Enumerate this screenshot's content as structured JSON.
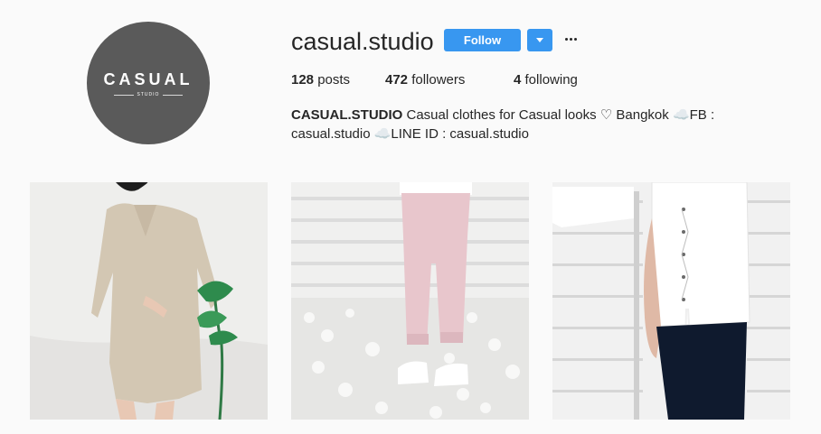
{
  "profile": {
    "username": "casual.studio",
    "avatar_logo_word": "CASUAL",
    "avatar_logo_sub": "STUDIO"
  },
  "actions": {
    "follow_label": "Follow",
    "dropdown_icon": "chevron-down-icon",
    "more_icon": "more-options-icon",
    "accent_color": "#3897f0"
  },
  "stats": {
    "posts_count": "128",
    "posts_label": "posts",
    "followers_count": "472",
    "followers_label": "followers",
    "following_count": "4",
    "following_label": "following"
  },
  "bio": {
    "full_name": "CASUAL.STUDIO",
    "text": " Casual clothes for Casual looks ♡ Bangkok ☁️FB : casual.studio ☁️LINE ID : casual.studio"
  },
  "posts": [
    {
      "subject": "beige-dress-with-plant"
    },
    {
      "subject": "pink-trousers-white-sneakers"
    },
    {
      "subject": "white-lace-up-top"
    }
  ]
}
